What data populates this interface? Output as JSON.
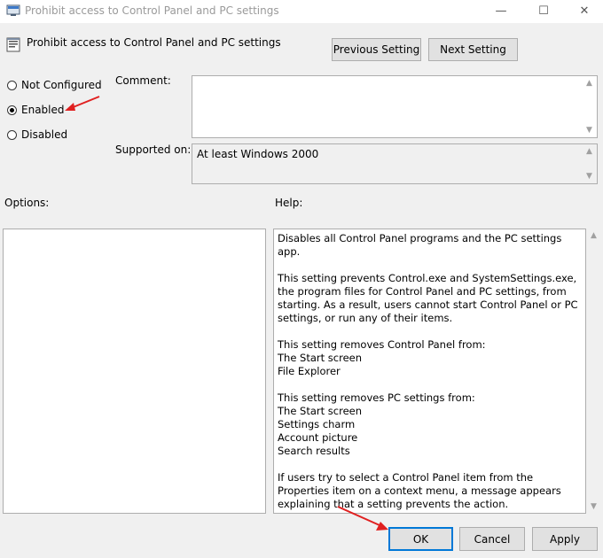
{
  "window": {
    "title": "Prohibit access to Control Panel and PC settings",
    "controls": {
      "minimize": "—",
      "maximize": "☐",
      "close": "✕"
    }
  },
  "header": {
    "policy_title": "Prohibit access to Control Panel and PC settings",
    "previous_label": "Previous Setting",
    "next_label": "Next Setting"
  },
  "state": {
    "options": [
      {
        "label": "Not Configured",
        "selected": false
      },
      {
        "label": "Enabled",
        "selected": true
      },
      {
        "label": "Disabled",
        "selected": false
      }
    ]
  },
  "comment": {
    "label": "Comment:",
    "value": ""
  },
  "supported": {
    "label": "Supported on:",
    "value": "At least Windows 2000"
  },
  "options_panel": {
    "label": "Options:"
  },
  "help_panel": {
    "label": "Help:",
    "text": "Disables all Control Panel programs and the PC settings app.\n\nThis setting prevents Control.exe and SystemSettings.exe, the program files for Control Panel and PC settings, from starting. As a result, users cannot start Control Panel or PC settings, or run any of their items.\n\nThis setting removes Control Panel from:\nThe Start screen\nFile Explorer\n\nThis setting removes PC settings from:\nThe Start screen\nSettings charm\nAccount picture\nSearch results\n\nIf users try to select a Control Panel item from the Properties item on a context menu, a message appears explaining that a setting prevents the action."
  },
  "footer": {
    "ok_label": "OK",
    "cancel_label": "Cancel",
    "apply_label": "Apply"
  },
  "colors": {
    "annotation_arrow": "#e02020",
    "focus_border": "#0078d7"
  }
}
